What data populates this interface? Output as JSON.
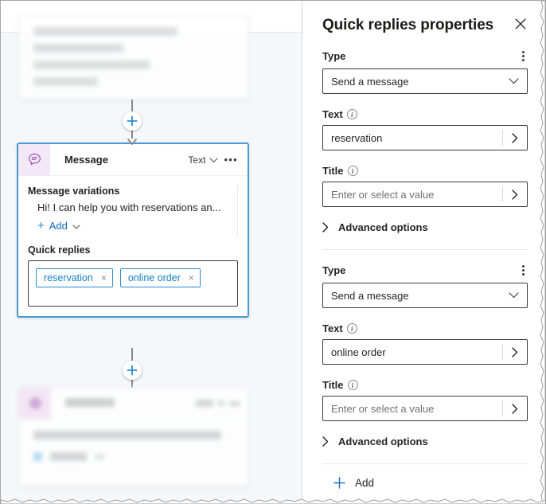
{
  "canvas": {
    "nodes": {
      "top_blurred": {
        "name": "blurred-node-above",
        "lines": 4
      },
      "message": {
        "icon": "message-bubble-icon",
        "title": "Message",
        "mode": "Text",
        "more_menu": "•••",
        "variations_label": "Message variations",
        "variation_text": "Hi! I can help you with reservations an...",
        "add_label": "Add",
        "quick_replies_label": "Quick replies",
        "quick_replies": [
          {
            "text": "reservation",
            "remove": "×"
          },
          {
            "text": "online order",
            "remove": "×"
          }
        ]
      },
      "bottom_blurred": {
        "name": "blurred-message-node-below",
        "title": "Message"
      }
    },
    "connector_add": "+"
  },
  "panel": {
    "title": "Quick replies properties",
    "close": "✕",
    "groups": [
      {
        "type_label": "Type",
        "type_value": "Send a message",
        "text_label": "Text",
        "text_value": "reservation",
        "title_label": "Title",
        "title_placeholder": "Enter or select a value",
        "advanced_label": "Advanced options"
      },
      {
        "type_label": "Type",
        "type_value": "Send a message",
        "text_label": "Text",
        "text_value": "online order",
        "title_label": "Title",
        "title_placeholder": "Enter or select a value",
        "advanced_label": "Advanced options"
      }
    ],
    "add_label": "Add",
    "info_glyph": "i"
  },
  "colors": {
    "accent_blue": "#0f6cbd",
    "chip_blue": "#1580c7",
    "node_selected": "#4a9ad4",
    "canvas_bg": "#f5f8fb",
    "icon_purple": "#8a3faa"
  }
}
